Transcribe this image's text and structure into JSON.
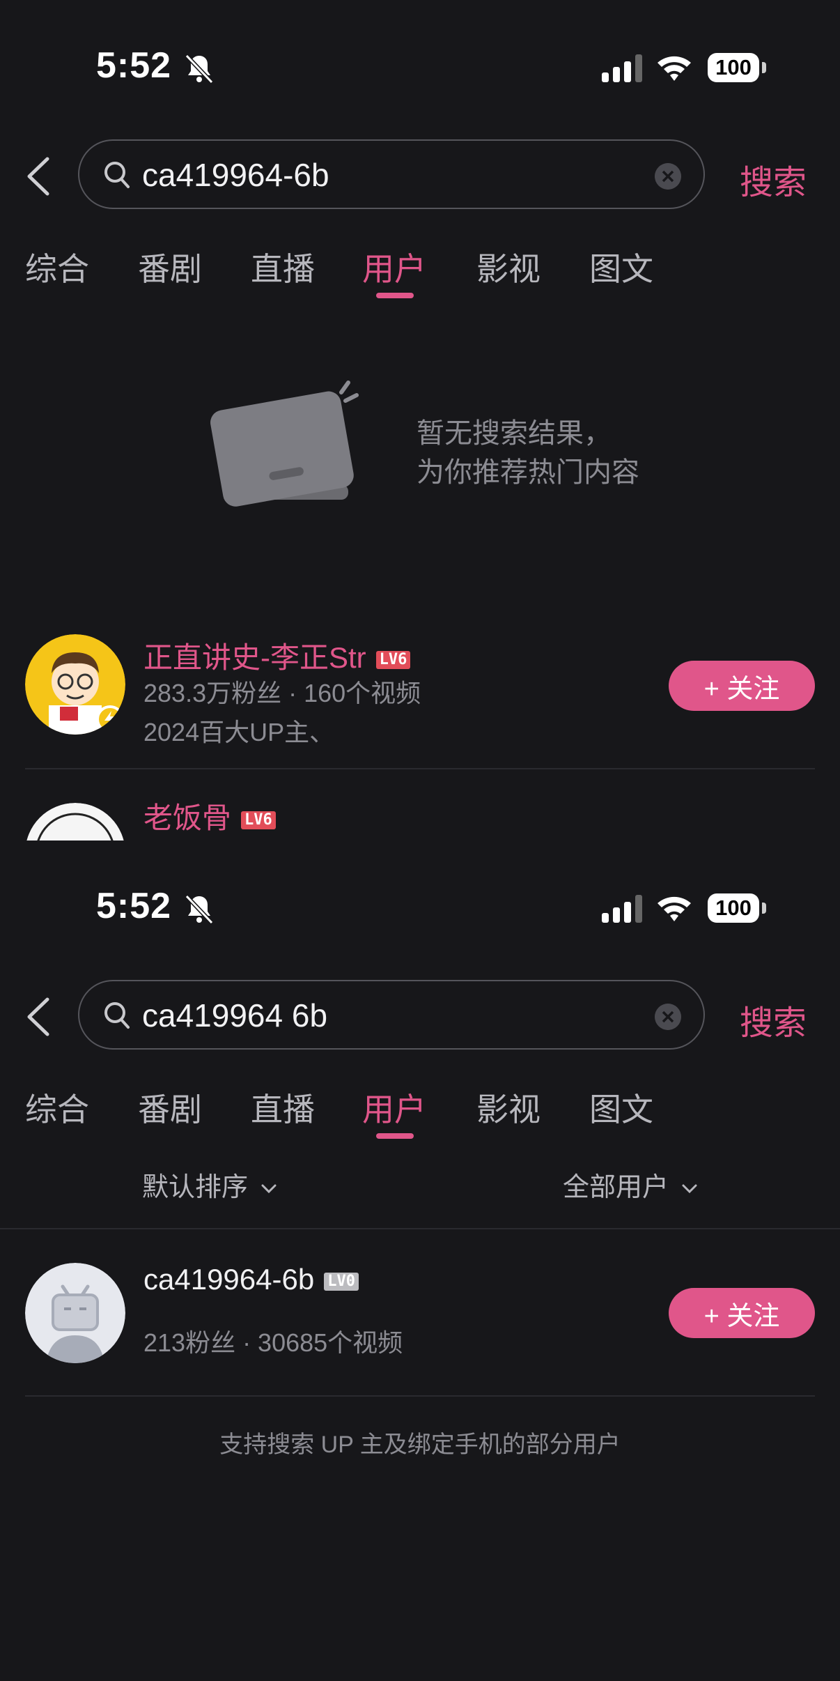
{
  "screens": [
    {
      "status": {
        "time": "5:52",
        "battery": "100"
      },
      "search": {
        "query": "ca419964-6b",
        "button": "搜索"
      },
      "tabs": [
        "综合",
        "番剧",
        "直播",
        "用户",
        "影视",
        "图文"
      ],
      "active_tab": "用户",
      "empty_state": {
        "line1": "暂无搜索结果，",
        "line2": "为你推荐热门内容"
      },
      "users": [
        {
          "name": "正直讲史-李正Str",
          "level": "LV6",
          "stats": "283.3万粉丝 · 160个视频",
          "desc": "2024百大UP主、",
          "follow": "+ 关注"
        },
        {
          "name": "老饭骨",
          "level": "LV6"
        }
      ]
    },
    {
      "status": {
        "time": "5:52",
        "battery": "100"
      },
      "search": {
        "query": "ca419964 6b",
        "button": "搜索"
      },
      "tabs": [
        "综合",
        "番剧",
        "直播",
        "用户",
        "影视",
        "图文"
      ],
      "active_tab": "用户",
      "sort": {
        "order": "默认排序",
        "filter": "全部用户"
      },
      "users": [
        {
          "name": "ca419964-6b",
          "level": "LV0",
          "stats": "213粉丝 · 30685个视频",
          "follow": "+ 关注"
        }
      ],
      "footer_note": "支持搜索 UP 主及绑定手机的部分用户"
    }
  ],
  "colors": {
    "accent": "#e0568a",
    "background": "#17171a",
    "level_badge": "#e24d59"
  },
  "icons": [
    "back-arrow-icon",
    "search-icon",
    "clear-icon",
    "bell-slash-icon",
    "signal-icon",
    "wifi-icon",
    "battery-icon",
    "chevron-down-icon"
  ]
}
